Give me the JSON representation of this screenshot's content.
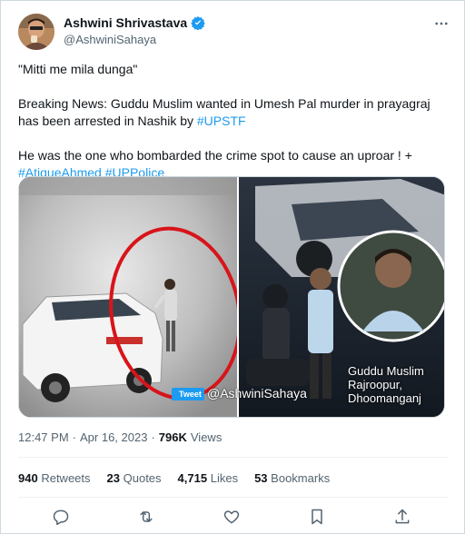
{
  "author": {
    "name": "Ashwini Shrivastava",
    "handle": "@AshwiniSahaya",
    "verified_badge_icon": "verified-badge-icon"
  },
  "tweet": {
    "line1": "\"Mitti me mila dunga\"",
    "line2_text": "Breaking News: Guddu Muslim wanted in Umesh Pal murder in prayagraj",
    "line3_text": "has been arrested in Nashik by ",
    "line3_link": "#UPSTF",
    "line4_text": "He was the one who bombarded the crime spot to cause an uproar ! +",
    "line5_link1": "#AtiqueAhmed",
    "line5_link2": "#UPPolice"
  },
  "media": {
    "watermark_label": "Tweet",
    "watermark_handle": "@AshwiniSahaya",
    "caption_line1": "Guddu Muslim",
    "caption_line2": "Rajroopur,",
    "caption_line3": "Dhoomanganj"
  },
  "meta": {
    "time": "12:47 PM",
    "separator1": "·",
    "date": "Apr 16, 2023",
    "separator2": "·",
    "views_count": "796K",
    "views_label": "Views"
  },
  "stats": {
    "retweets_count": "940",
    "retweets_label": "Retweets",
    "quotes_count": "23",
    "quotes_label": "Quotes",
    "likes_count": "4,715",
    "likes_label": "Likes",
    "bookmarks_count": "53",
    "bookmarks_label": "Bookmarks"
  },
  "colors": {
    "link": "#1d9bf0",
    "text": "#0f1419",
    "secondary": "#536471",
    "border": "#cfd9de"
  }
}
